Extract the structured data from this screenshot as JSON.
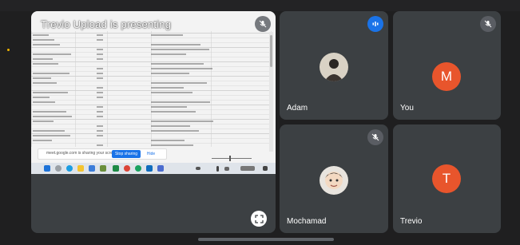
{
  "colors": {
    "background": "#1f1f20",
    "tile": "#3c4043",
    "avatar_orange": "#e8552c",
    "speaking_blue": "#1a73e8",
    "accent_dot": "#f0b400"
  },
  "presentation": {
    "title": "Trevio Upload is presenting",
    "notify_text": "meet.google.com is sharing your screen.",
    "notify_stop": "Stop sharing",
    "notify_hide": "Hide",
    "fullscreen_icon": "fullscreen-icon",
    "mute_icon": "mic-off-icon"
  },
  "participants": [
    {
      "name": "Adam",
      "status_icon": "speaking-icon",
      "avatar_type": "photo"
    },
    {
      "name": "You",
      "status_icon": "mic-off-icon",
      "avatar_type": "letter",
      "initial": "M"
    },
    {
      "name": "Mochamad",
      "status_icon": "mic-off-icon",
      "avatar_type": "photo"
    },
    {
      "name": "Trevio",
      "status_icon": "none",
      "avatar_type": "letter",
      "initial": "T"
    }
  ]
}
